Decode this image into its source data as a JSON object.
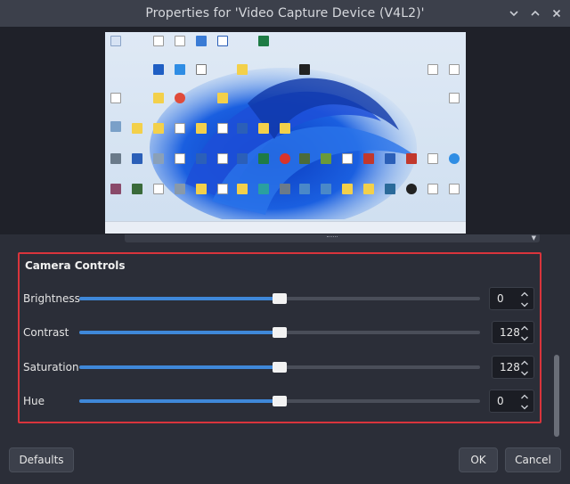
{
  "window": {
    "title": "Properties for 'Video Capture Device (V4L2)'",
    "controls": [
      "collapse",
      "chevron-up",
      "close"
    ]
  },
  "preview": {
    "content": "desktop-screenshot"
  },
  "camera_controls": {
    "title": "Camera Controls",
    "rows": [
      {
        "label": "Brightness",
        "value": "0",
        "level": 0.5
      },
      {
        "label": "Contrast",
        "value": "128",
        "level": 0.5
      },
      {
        "label": "Saturation",
        "value": "128",
        "level": 0.5
      },
      {
        "label": "Hue",
        "value": "0",
        "level": 0.5
      }
    ]
  },
  "buttons": {
    "defaults": "Defaults",
    "ok": "OK",
    "cancel": "Cancel"
  },
  "colors": {
    "accent": "#3f88d9",
    "highlight_border": "#d9343c"
  }
}
